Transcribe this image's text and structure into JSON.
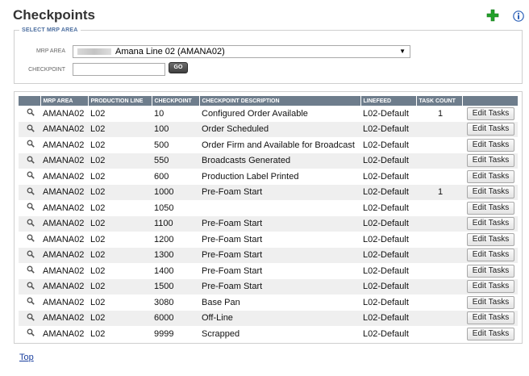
{
  "page": {
    "title": "Checkpoints"
  },
  "icons": {
    "add": "plus-icon",
    "info": "info-icon",
    "row_view": "magnifier-icon"
  },
  "colors": {
    "add_icon": "#22a12a",
    "info_icon": "#2a5fb7",
    "header_bg": "#6e7d8c",
    "legend": "#4d6fa0",
    "link": "#1a3f9e"
  },
  "mrp_section": {
    "legend": "SELECT MRP AREA",
    "mrp_area_label": "MRP AREA",
    "mrp_area_selected": "Amana Line 02 (AMANA02)",
    "checkpoint_label": "CHECKPOINT",
    "checkpoint_value": "",
    "go_label": "GO"
  },
  "table": {
    "headers": [
      "",
      "MRP AREA",
      "PRODUCTION LINE",
      "CHECKPOINT",
      "CHECKPOINT DESCRIPTION",
      "LINEFEED",
      "TASK COUNT",
      ""
    ],
    "edit_label": "Edit Tasks",
    "rows": [
      {
        "mrp": "AMANA02",
        "line": "L02",
        "checkpoint": "10",
        "description": "Configured Order Available",
        "linefeed": "L02-Default",
        "task_count": "1"
      },
      {
        "mrp": "AMANA02",
        "line": "L02",
        "checkpoint": "100",
        "description": "Order Scheduled",
        "linefeed": "L02-Default",
        "task_count": ""
      },
      {
        "mrp": "AMANA02",
        "line": "L02",
        "checkpoint": "500",
        "description": "Order Firm and Available for Broadcast",
        "linefeed": "L02-Default",
        "task_count": ""
      },
      {
        "mrp": "AMANA02",
        "line": "L02",
        "checkpoint": "550",
        "description": "Broadcasts Generated",
        "linefeed": "L02-Default",
        "task_count": ""
      },
      {
        "mrp": "AMANA02",
        "line": "L02",
        "checkpoint": "600",
        "description": "Production Label Printed",
        "linefeed": "L02-Default",
        "task_count": ""
      },
      {
        "mrp": "AMANA02",
        "line": "L02",
        "checkpoint": "1000",
        "description": "Pre-Foam Start",
        "linefeed": "L02-Default",
        "task_count": "1"
      },
      {
        "mrp": "AMANA02",
        "line": "L02",
        "checkpoint": "1050",
        "description": "",
        "linefeed": "L02-Default",
        "task_count": ""
      },
      {
        "mrp": "AMANA02",
        "line": "L02",
        "checkpoint": "1100",
        "description": "Pre-Foam Start",
        "linefeed": "L02-Default",
        "task_count": ""
      },
      {
        "mrp": "AMANA02",
        "line": "L02",
        "checkpoint": "1200",
        "description": "Pre-Foam Start",
        "linefeed": "L02-Default",
        "task_count": ""
      },
      {
        "mrp": "AMANA02",
        "line": "L02",
        "checkpoint": "1300",
        "description": "Pre-Foam Start",
        "linefeed": "L02-Default",
        "task_count": ""
      },
      {
        "mrp": "AMANA02",
        "line": "L02",
        "checkpoint": "1400",
        "description": "Pre-Foam Start",
        "linefeed": "L02-Default",
        "task_count": ""
      },
      {
        "mrp": "AMANA02",
        "line": "L02",
        "checkpoint": "1500",
        "description": "Pre-Foam Start",
        "linefeed": "L02-Default",
        "task_count": ""
      },
      {
        "mrp": "AMANA02",
        "line": "L02",
        "checkpoint": "3080",
        "description": "Base Pan",
        "linefeed": "L02-Default",
        "task_count": ""
      },
      {
        "mrp": "AMANA02",
        "line": "L02",
        "checkpoint": "6000",
        "description": "Off-Line",
        "linefeed": "L02-Default",
        "task_count": ""
      },
      {
        "mrp": "AMANA02",
        "line": "L02",
        "checkpoint": "9999",
        "description": "Scrapped",
        "linefeed": "L02-Default",
        "task_count": ""
      }
    ]
  },
  "footer": {
    "top_link": "Top"
  }
}
